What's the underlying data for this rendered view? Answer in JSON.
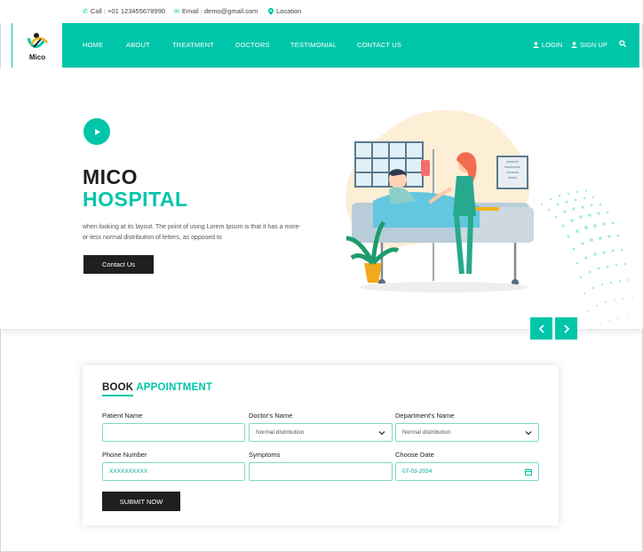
{
  "topbar": {
    "call": "Call : +01 123455678990",
    "email": "Email : demo@gmail.com",
    "location": "Location"
  },
  "brand": {
    "logo_text": "Mico"
  },
  "nav": {
    "items": [
      "HOME",
      "ABOUT",
      "TREATMENT",
      "DOCTORS",
      "TESTIMONIAL",
      "CONTACT US"
    ],
    "login": "LOGIN",
    "signup": "SIGN UP"
  },
  "hero": {
    "title_line1": "MICO",
    "title_line2": "HOSPITAL",
    "description": "when looking at its layout. The point of using Lorem Ipsum is that it has a more-or-less normal distribution of letters, as opposed to",
    "contact_button": "Contact Us"
  },
  "appointment": {
    "title_part1": "BOOK",
    "title_part2": "APPOINTMENT",
    "labels": {
      "patient_name": "Patient Name",
      "doctor_name": "Doctor's Name",
      "department": "Department's Name",
      "phone": "Phone Number",
      "symptoms": "Symptoms",
      "date": "Choose Date"
    },
    "values": {
      "patient_name": "",
      "doctor_name": "Normal distribution",
      "department": "Normal distribution",
      "phone": "XXXXXXXXXX",
      "symptoms": "",
      "date": "07-03-2024"
    },
    "submit": "SUBMIT NOW"
  },
  "colors": {
    "accent": "#00c6a9",
    "dark": "#1f1f1f"
  }
}
